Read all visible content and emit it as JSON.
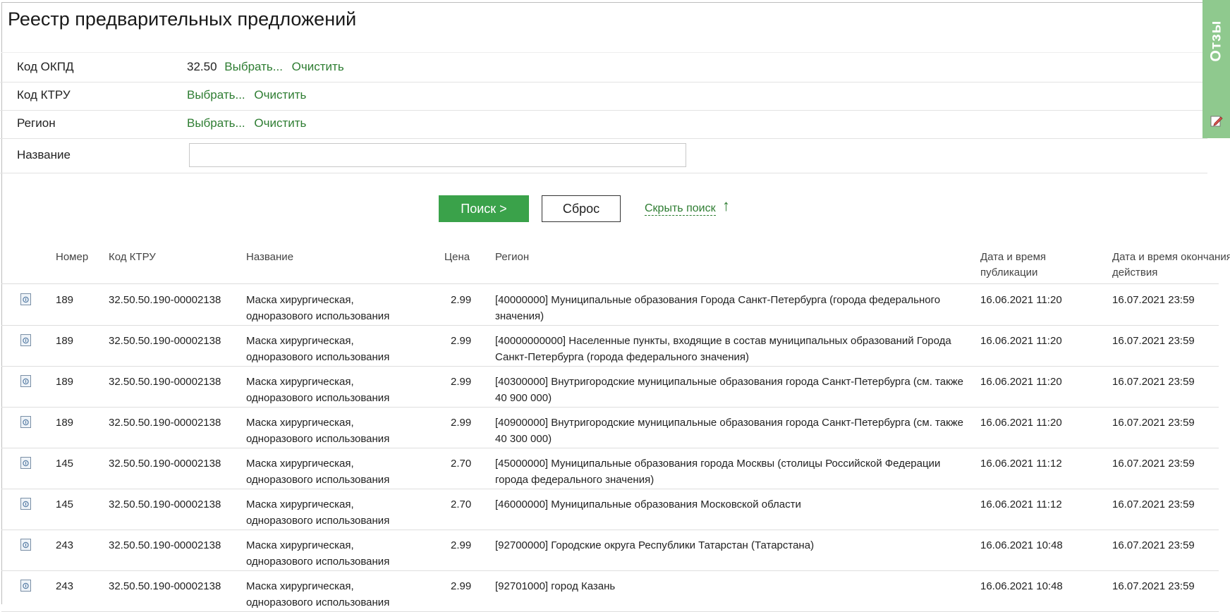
{
  "page": {
    "title": "Реестр предварительных предложений"
  },
  "filters": {
    "okpd": {
      "label": "Код ОКПД",
      "value": "32.50",
      "select": "Выбрать...",
      "clear": "Очистить"
    },
    "ktru": {
      "label": "Код КТРУ",
      "select": "Выбрать...",
      "clear": "Очистить"
    },
    "region": {
      "label": "Регион",
      "select": "Выбрать...",
      "clear": "Очистить"
    },
    "name": {
      "label": "Название",
      "value": ""
    }
  },
  "actions": {
    "search": "Поиск >",
    "reset": "Сброс",
    "hide_search": "Скрыть поиск",
    "hide_arrow": "↑"
  },
  "table": {
    "headers": {
      "number": "Номер",
      "ktru": "Код КТРУ",
      "name": "Название",
      "price": "Цена",
      "region": "Регион",
      "published": "Дата и время публикации",
      "end": "Дата и время окончания действия"
    },
    "rows": [
      {
        "number": "189",
        "ktru": "32.50.50.190-00002138",
        "name": "Маска хирургическая, одноразового использования",
        "price": "2.99",
        "region": "[40000000] Муниципальные образования Города Санкт-Петербурга (города федерального значения)",
        "published": "16.06.2021 11:20",
        "end": "16.07.2021 23:59"
      },
      {
        "number": "189",
        "ktru": "32.50.50.190-00002138",
        "name": "Маска хирургическая, одноразового использования",
        "price": "2.99",
        "region": "[40000000000] Населенные пункты, входящие в состав муниципальных образований Города Санкт-Петербурга (города федерального значения)",
        "published": "16.06.2021 11:20",
        "end": "16.07.2021 23:59"
      },
      {
        "number": "189",
        "ktru": "32.50.50.190-00002138",
        "name": "Маска хирургическая, одноразового использования",
        "price": "2.99",
        "region": "[40300000] Внутригородские муниципальные образования города Санкт-Петербурга (см. также 40 900 000)",
        "published": "16.06.2021 11:20",
        "end": "16.07.2021 23:59"
      },
      {
        "number": "189",
        "ktru": "32.50.50.190-00002138",
        "name": "Маска хирургическая, одноразового использования",
        "price": "2.99",
        "region": "[40900000] Внутригородские муниципальные образования города Санкт-Петербурга (см. также 40 300 000)",
        "published": "16.06.2021 11:20",
        "end": "16.07.2021 23:59"
      },
      {
        "number": "145",
        "ktru": "32.50.50.190-00002138",
        "name": "Маска хирургическая, одноразового использования",
        "price": "2.70",
        "region": "[45000000] Муниципальные образования города Москвы (столицы Российской Федерации города федерального значения)",
        "published": "16.06.2021 11:12",
        "end": "16.07.2021 23:59"
      },
      {
        "number": "145",
        "ktru": "32.50.50.190-00002138",
        "name": "Маска хирургическая, одноразового использования",
        "price": "2.70",
        "region": "[46000000] Муниципальные образования Московской области",
        "published": "16.06.2021 11:12",
        "end": "16.07.2021 23:59"
      },
      {
        "number": "243",
        "ktru": "32.50.50.190-00002138",
        "name": "Маска хирургическая, одноразового использования",
        "price": "2.99",
        "region": "[92700000] Городские округа Республики Татарстан (Татарстана)",
        "published": "16.06.2021 10:48",
        "end": "16.07.2021 23:59"
      },
      {
        "number": "243",
        "ktru": "32.50.50.190-00002138",
        "name": "Маска хирургическая, одноразового использования",
        "price": "2.99",
        "region": "[92701000] город Казань",
        "published": "16.06.2021 10:48",
        "end": "16.07.2021 23:59"
      }
    ]
  },
  "feedback": {
    "label": "Отзы",
    "icon": "edit-icon"
  },
  "colors": {
    "accent": "#3aa24a",
    "link": "#2e7d32",
    "feedback": "#8fc98e"
  }
}
